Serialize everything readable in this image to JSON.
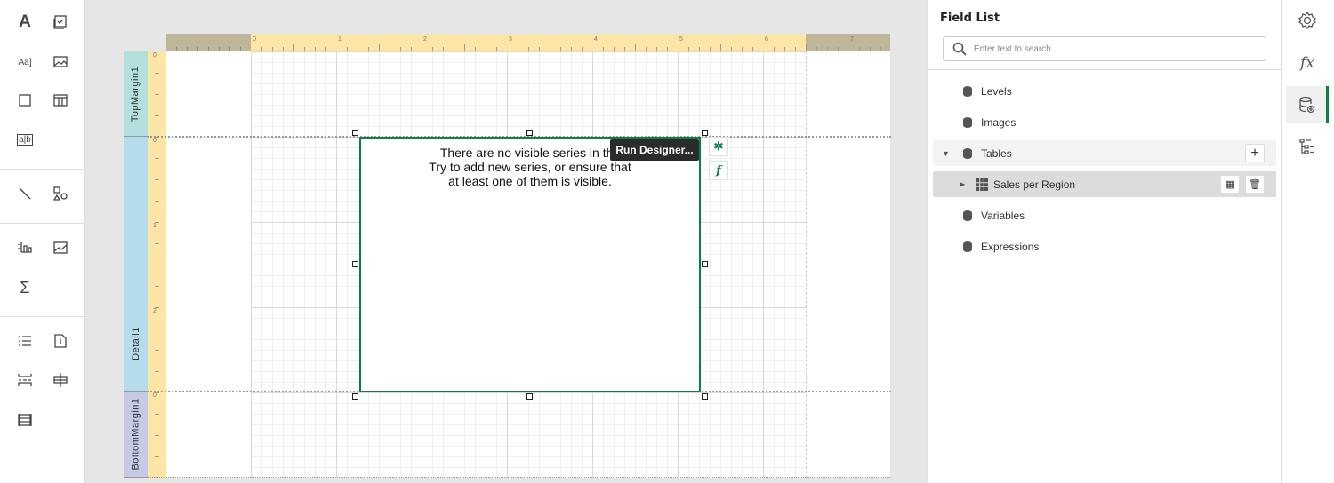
{
  "toolbox": {
    "items": [
      "label",
      "checkbox",
      "character-comb",
      "picture-box",
      "panel",
      "table",
      "rich-text",
      "line",
      "shape",
      "chart",
      "sparkline",
      "summary",
      "bullet-list",
      "page-info",
      "page-break",
      "cross-band",
      "table-of-contents"
    ]
  },
  "ruler": {
    "top_labels": [
      "0",
      "1",
      "2",
      "3",
      "4",
      "5",
      "6",
      "7"
    ],
    "left_labels": [
      "0",
      "0",
      "1",
      "2",
      "0"
    ]
  },
  "bands": {
    "top": "TopMargin1",
    "detail": "Detail1",
    "bottom": "BottomMargin1"
  },
  "chart": {
    "message_lines": [
      "There are no visible series in the",
      "Try to add new series, or ensure that",
      "at least one of them is visible."
    ],
    "tooltip": "Run Designer...",
    "accent": "#0b8043"
  },
  "field_list": {
    "title": "Field List",
    "search_placeholder": "Enter text to search...",
    "items": [
      {
        "label": "Levels"
      },
      {
        "label": "Images"
      },
      {
        "label": "Tables",
        "expanded": true
      },
      {
        "label": "Sales per Region",
        "selected": true
      },
      {
        "label": "Variables"
      },
      {
        "label": "Expressions"
      }
    ]
  },
  "rail": {
    "items": [
      "settings-icon",
      "function-icon",
      "data-source-icon",
      "report-explorer-icon"
    ],
    "active": "data-source-icon"
  }
}
